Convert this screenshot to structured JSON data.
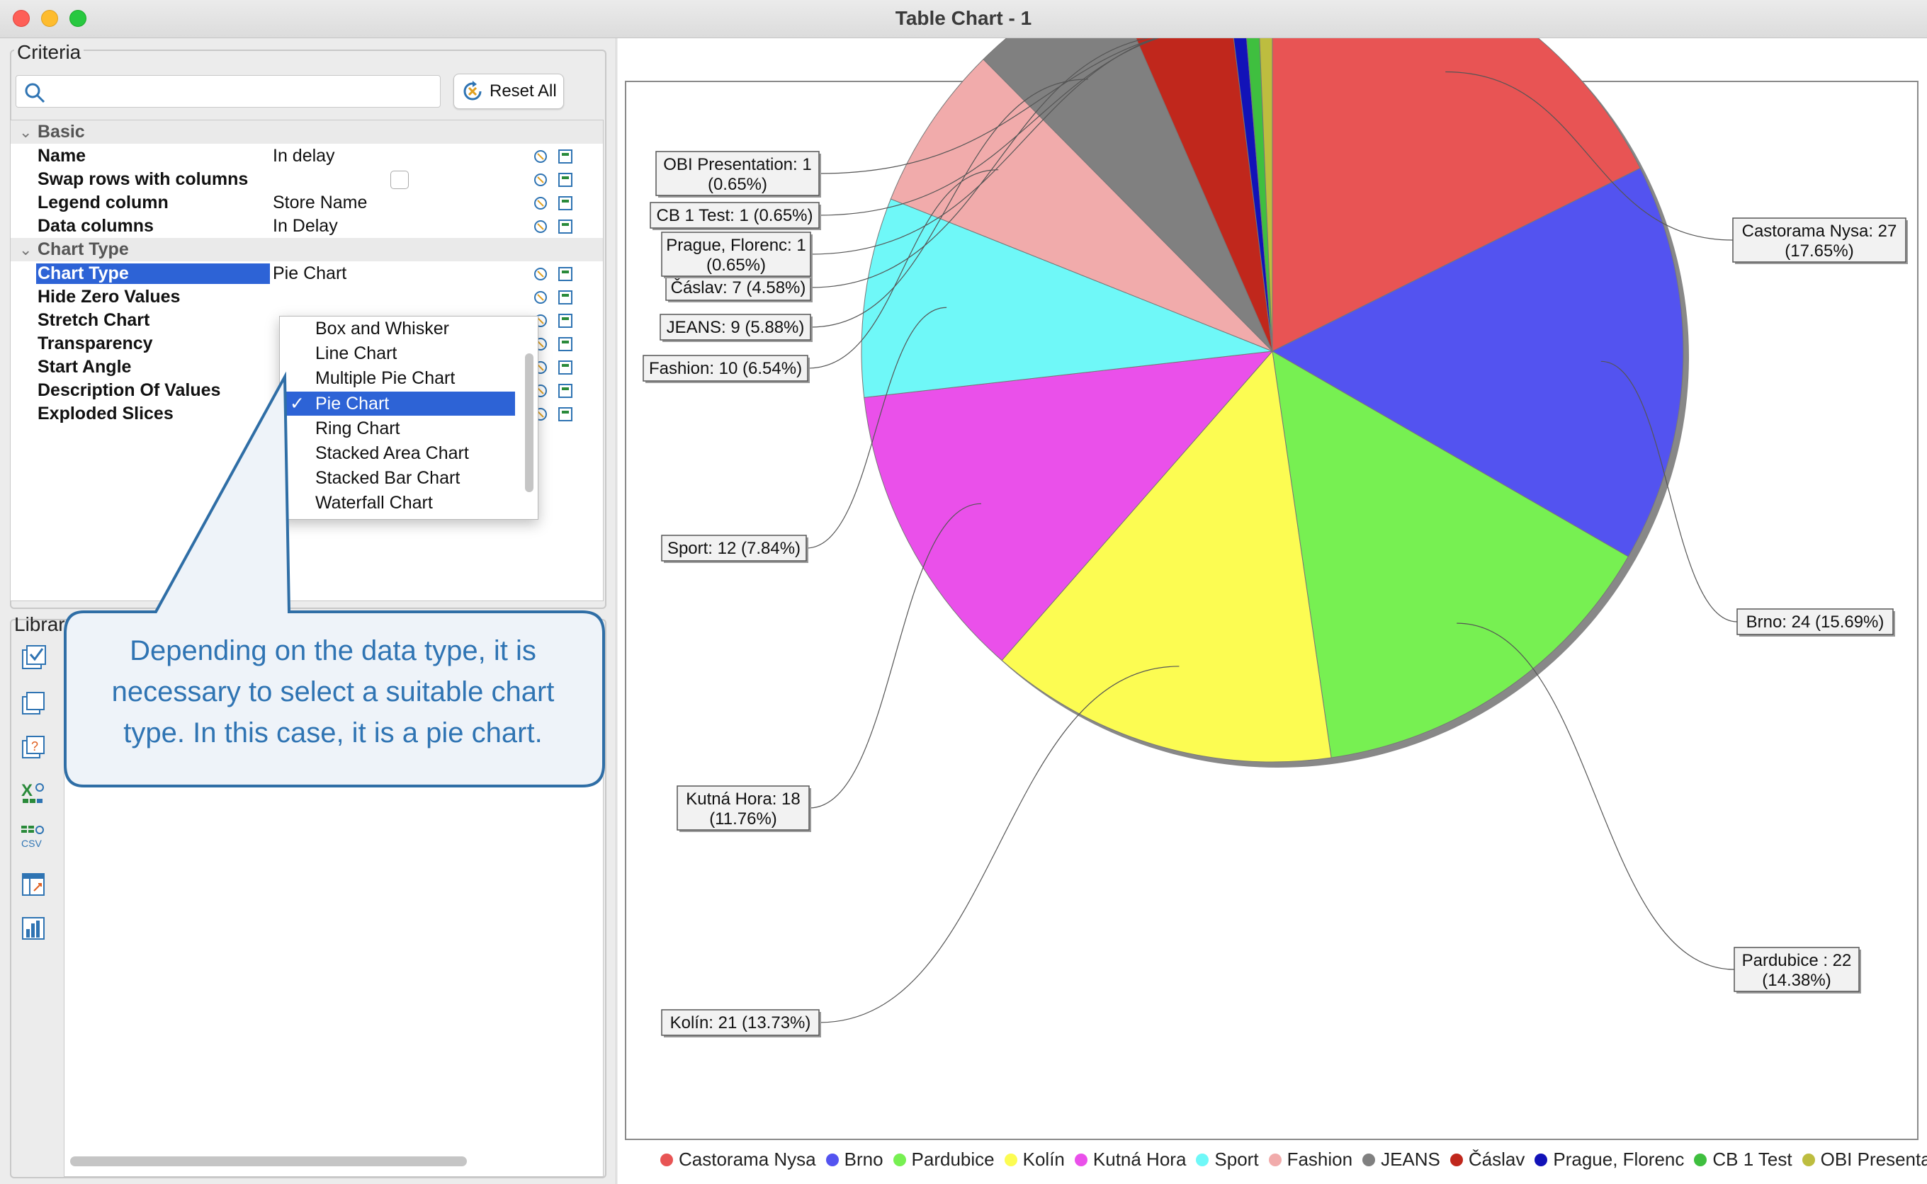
{
  "window": {
    "title": "Table Chart - 1"
  },
  "criteria": {
    "title": "Criteria",
    "search_placeholder": "",
    "reset_label": "Reset All",
    "sections": {
      "basic": "Basic",
      "chart_type": "Chart Type"
    },
    "basic_rows": [
      {
        "label": "Name",
        "value": "In delay"
      },
      {
        "label": "Swap rows with columns",
        "value": ""
      },
      {
        "label": "Legend column",
        "value": "Store Name"
      },
      {
        "label": "Data columns",
        "value": "In Delay"
      }
    ],
    "chart_rows": [
      {
        "label": "Chart Type",
        "value": "Pie Chart"
      },
      {
        "label": "Hide Zero Values",
        "value": ""
      },
      {
        "label": "Stretch Chart",
        "value": ""
      },
      {
        "label": "Transparency",
        "value": ""
      },
      {
        "label": "Start Angle",
        "value": ""
      },
      {
        "label": "Description Of Values",
        "value": ""
      },
      {
        "label": "Exploded Slices",
        "value": ""
      }
    ],
    "dropdown_options": [
      "Box and Whisker",
      "Line Chart",
      "Multiple Pie Chart",
      "Pie Chart",
      "Ring Chart",
      "Stacked Area Chart",
      "Stacked Bar Chart",
      "Waterfall Chart"
    ],
    "dropdown_selected": "Pie Chart"
  },
  "library": {
    "title": "Librar"
  },
  "callout": {
    "lines": [
      "Depending on the data type, it is",
      "necessary to select a suitable chart",
      "type. In this case, it is a pie chart."
    ]
  },
  "chart_data": {
    "type": "pie",
    "title": "In delay",
    "start_angle_deg": 90,
    "direction": "clockwise",
    "slices": [
      {
        "name": "Castorama Nysa",
        "value": 27,
        "percent": "17.65%",
        "label": "Castorama Nysa: 27\n(17.65%)",
        "color": "#e85454"
      },
      {
        "name": "Brno",
        "value": 24,
        "percent": "15.69%",
        "label": "Brno: 24 (15.69%)",
        "color": "#5353f0"
      },
      {
        "name": "Pardubice",
        "value": 22,
        "percent": "14.38%",
        "label": "Pardubice : 22\n(14.38%)",
        "color": "#77f052"
      },
      {
        "name": "Kolín",
        "value": 21,
        "percent": "13.73%",
        "label": "Kolín: 21 (13.73%)",
        "color": "#fcfc52"
      },
      {
        "name": "Kutná Hora",
        "value": 18,
        "percent": "11.76%",
        "label": "Kutná Hora: 18\n(11.76%)",
        "color": "#ea50ea"
      },
      {
        "name": "Sport",
        "value": 12,
        "percent": "7.84%",
        "label": "Sport: 12 (7.84%)",
        "color": "#6ff8f8"
      },
      {
        "name": "Fashion",
        "value": 10,
        "percent": "6.54%",
        "label": "Fashion: 10 (6.54%)",
        "color": "#f1abab"
      },
      {
        "name": "JEANS",
        "value": 9,
        "percent": "5.88%",
        "label": "JEANS: 9 (5.88%)",
        "color": "#808080"
      },
      {
        "name": "Čáslav",
        "value": 7,
        "percent": "4.58%",
        "label": "Čáslav: 7 (4.58%)",
        "color": "#c0271c"
      },
      {
        "name": "Prague, Florenc",
        "value": 1,
        "percent": "0.65%",
        "label": "Prague, Florenc: 1\n(0.65%)",
        "color": "#1212b8"
      },
      {
        "name": "CB 1 Test",
        "value": 1,
        "percent": "0.65%",
        "label": "CB 1 Test: 1 (0.65%)",
        "color": "#3fbf3f"
      },
      {
        "name": "OBI Presentation",
        "value": 1,
        "percent": "0.65%",
        "label": "OBI Presentation: 1\n(0.65%)",
        "color": "#bdbd3f"
      }
    ],
    "legend_placement": "bottom"
  }
}
